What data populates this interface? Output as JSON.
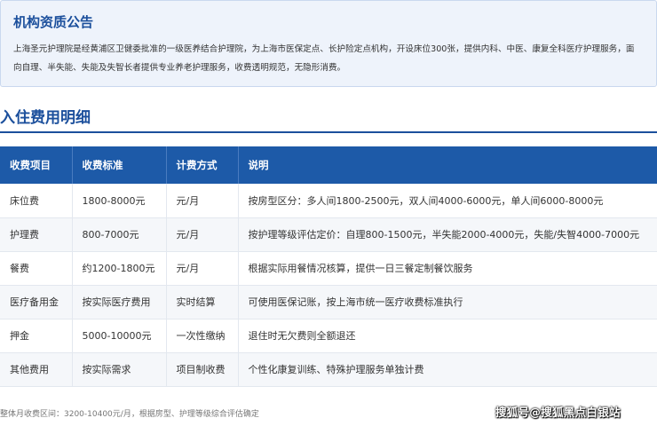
{
  "notice": {
    "title": "机构资质公告",
    "body": "上海圣元护理院是经黄浦区卫健委批准的一级医养结合护理院，为上海市医保定点、长护险定点机构，开设床位300张，提供内科、中医、康复全科医疗护理服务，面向自理、半失能、失能及失智长者提供专业养老护理服务，收费透明规范，无隐形消费。"
  },
  "section": {
    "title": "入住费用明细"
  },
  "table": {
    "headers": [
      "收费项目",
      "收费标准",
      "计费方式",
      "说明"
    ],
    "rows": [
      [
        "床位费",
        "1800-8000元",
        "元/月",
        "按房型区分：多人间1800-2500元，双人间4000-6000元，单人间6000-8000元"
      ],
      [
        "护理费",
        "800-7000元",
        "元/月",
        "按护理等级评估定价：自理800-1500元，半失能2000-4000元，失能/失智4000-7000元"
      ],
      [
        "餐费",
        "约1200-1800元",
        "元/月",
        "根据实际用餐情况核算，提供一日三餐定制餐饮服务"
      ],
      [
        "医疗备用金",
        "按实际医疗费用",
        "实时结算",
        "可使用医保记账，按上海市统一医疗收费标准执行"
      ],
      [
        "押金",
        "5000-10000元",
        "一次性缴纳",
        "退住时无欠费则全额退还"
      ],
      [
        "其他费用",
        "按实际需求",
        "项目制收费",
        "个性化康复训练、特殊护理服务单独计费"
      ]
    ]
  },
  "footer": {
    "note": "整体月收费区间：3200-10400元/月，根据房型、护理等级综合评估确定",
    "watermark": "搜狐号@搜狐黑点白银站"
  }
}
